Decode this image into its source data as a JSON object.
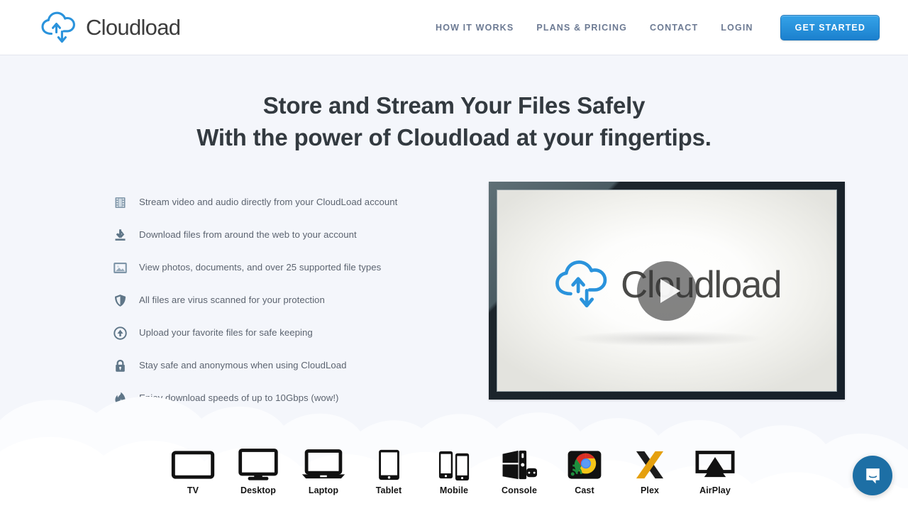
{
  "brand": {
    "name": "Cloudload",
    "logo_icon": "cloud-upload-download-icon",
    "accent_color": "#2a93dc",
    "text_color": "#3d3d3d"
  },
  "header": {
    "nav": [
      {
        "label": "HOW IT WORKS",
        "name": "nav-link-how-it-works"
      },
      {
        "label": "PLANS & PRICING",
        "name": "nav-link-plans-pricing"
      },
      {
        "label": "CONTACT",
        "name": "nav-link-contact"
      },
      {
        "label": "LOGIN",
        "name": "nav-link-login"
      }
    ],
    "cta": {
      "label": "GET STARTED",
      "color": "#1b80ce"
    }
  },
  "hero": {
    "headline_line1": "Store and Stream Your Files Safely",
    "headline_line2": "With the power of Cloudload at your fingertips.",
    "features": [
      {
        "icon": "film-strip-icon",
        "text": "Stream video and audio directly from your CloudLoad account"
      },
      {
        "icon": "download-icon",
        "text": "Download files from around the web to your account"
      },
      {
        "icon": "photo-icon",
        "text": "View photos, documents, and over 25 supported file types"
      },
      {
        "icon": "shield-icon",
        "text": "All files are virus scanned for your protection"
      },
      {
        "icon": "upload-circle-icon",
        "text": "Upload your favorite files for safe keeping"
      },
      {
        "icon": "lock-icon",
        "text": "Stay safe and anonymous when using CloudLoad"
      },
      {
        "icon": "flame-icon",
        "text": "Enjoy download speeds of up to 10Gbps (wow!)"
      }
    ],
    "video": {
      "name": "promo-video-player",
      "play_icon": "play-icon",
      "poster_logo_text": "Cloudload"
    }
  },
  "devices": [
    {
      "label": "TV",
      "icon": "tv-icon"
    },
    {
      "label": "Desktop",
      "icon": "desktop-monitor-icon"
    },
    {
      "label": "Laptop",
      "icon": "laptop-icon"
    },
    {
      "label": "Tablet",
      "icon": "tablet-icon"
    },
    {
      "label": "Mobile",
      "icon": "mobile-phones-icon"
    },
    {
      "label": "Console",
      "icon": "game-console-icon"
    },
    {
      "label": "Cast",
      "icon": "chromecast-icon"
    },
    {
      "label": "Plex",
      "icon": "plex-x-icon"
    },
    {
      "label": "AirPlay",
      "icon": "airplay-icon"
    }
  ],
  "support": {
    "chat_icon": "intercom-messenger-icon",
    "color": "#1d6fa5"
  }
}
